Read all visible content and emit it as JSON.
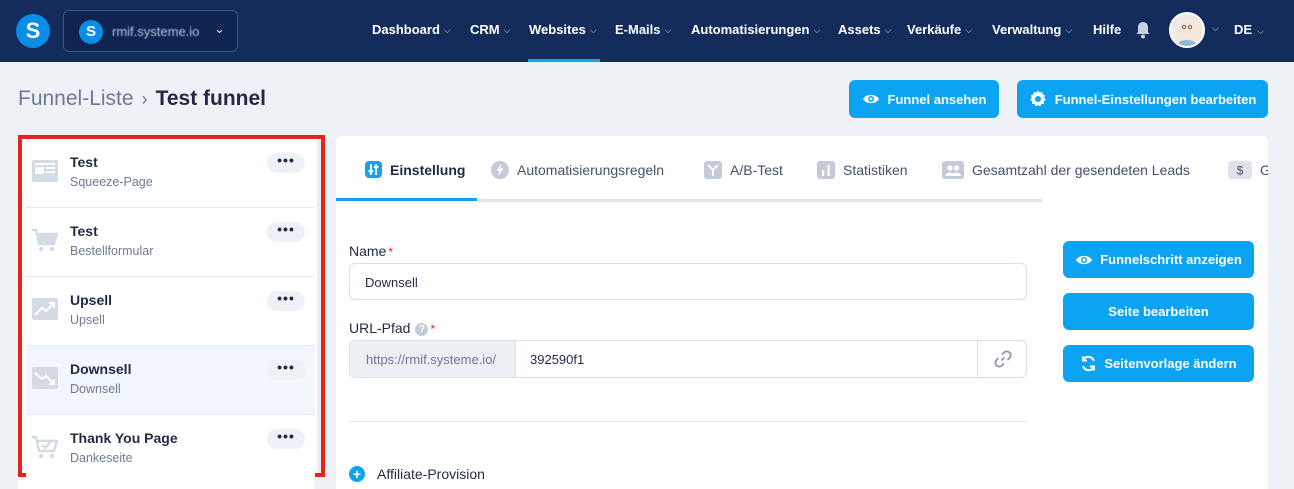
{
  "navbar": {
    "logo": "S",
    "workspace": {
      "logo": "S",
      "name": "rmif.systeme.io"
    },
    "items": [
      {
        "label": "Dashboard",
        "active": false
      },
      {
        "label": "CRM",
        "active": false
      },
      {
        "label": "Websites",
        "active": true
      },
      {
        "label": "E-Mails",
        "active": false
      },
      {
        "label": "Automatisierungen",
        "active": false
      },
      {
        "label": "Assets",
        "active": false
      },
      {
        "label": "Verkäufe",
        "active": false
      },
      {
        "label": "Verwaltung",
        "active": false
      }
    ],
    "help": "Hilfe",
    "language": "DE",
    "accent_color": "#16a0f0",
    "background_color": "#142c5c"
  },
  "breadcrumb": {
    "parent": "Funnel-Liste",
    "separator": "›",
    "current": "Test funnel"
  },
  "header_buttons": {
    "view_funnel": "Funnel ansehen",
    "edit_settings": "Funnel-Einstellungen bearbeiten"
  },
  "sidebar": {
    "items": [
      {
        "title": "Test",
        "subtitle": "Squeeze-Page",
        "icon": "squeeze-page-icon",
        "selected": false
      },
      {
        "title": "Test",
        "subtitle": "Bestellformular",
        "icon": "cart-icon",
        "selected": false
      },
      {
        "title": "Upsell",
        "subtitle": "Upsell",
        "icon": "upsell-chart-icon",
        "selected": false
      },
      {
        "title": "Downsell",
        "subtitle": "Downsell",
        "icon": "downsell-chart-icon",
        "selected": true
      },
      {
        "title": "Thank You Page",
        "subtitle": "Dankeseite",
        "icon": "cart-check-icon",
        "selected": false
      }
    ],
    "more_label": "•••",
    "highlight_color": "#e8231b"
  },
  "tabs": [
    {
      "label": "Einstellung",
      "icon": "sliders-icon",
      "active": true
    },
    {
      "label": "Automatisierungsregeln",
      "icon": "bolt-icon",
      "active": false
    },
    {
      "label": "A/B-Test",
      "icon": "split-icon",
      "active": false
    },
    {
      "label": "Statistiken",
      "icon": "bar-chart-icon",
      "active": false
    },
    {
      "label": "Gesamtzahl der gesendeten Leads",
      "icon": "users-icon",
      "active": false
    },
    {
      "label": "G",
      "icon": "dollar-icon",
      "active": false
    }
  ],
  "form": {
    "name_label": "Name",
    "name_value": "Downsell",
    "url_label": "URL-Pfad",
    "url_help": "?",
    "required_mark": "*",
    "url_prefix": "https://rmif.systeme.io/",
    "url_value": "392590f1",
    "affiliate_label": "Affiliate-Provision",
    "affiliate_plus": "+"
  },
  "side_buttons": {
    "show_step": "Funnelschritt anzeigen",
    "edit_page": "Seite bearbeiten",
    "change_template": "Seitenvorlage ändern"
  }
}
